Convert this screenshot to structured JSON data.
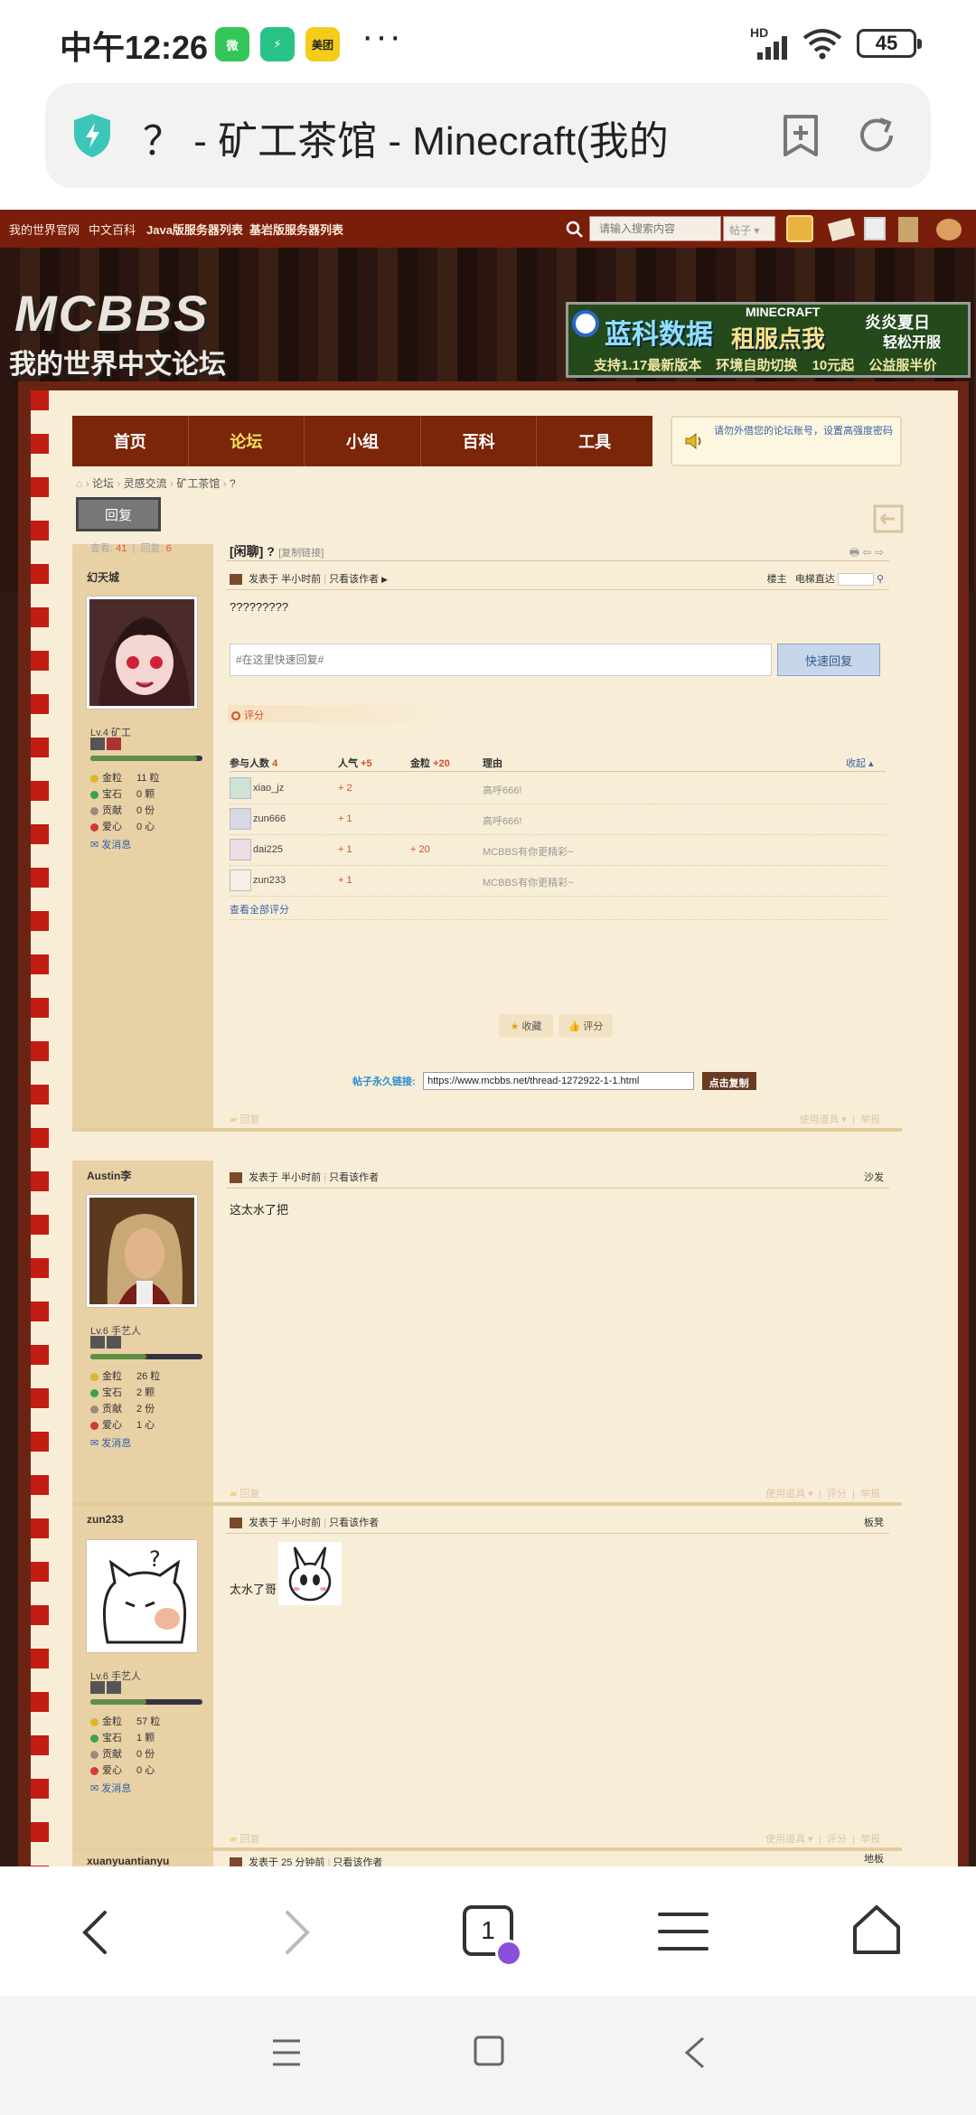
{
  "status_bar": {
    "time": "中午12:26",
    "apps": [
      {
        "name": "wechat-icon",
        "label": "微",
        "color": "#33c759"
      },
      {
        "name": "accelerator-icon",
        "label": "⚡",
        "color": "#29c286"
      },
      {
        "name": "meituan-icon",
        "label": "美团",
        "color": "#f5cc1b"
      }
    ],
    "more": "···",
    "network": "HD",
    "battery": "45"
  },
  "address_bar": {
    "title": "？ - 矿工茶馆 - Minecraft(我的"
  },
  "forum": {
    "top_links": [
      "我的世界官网",
      "中文百科",
      "Java版服务器列表",
      "基岩版服务器列表"
    ],
    "search_placeholder": "请输入搜索内容",
    "search_scope": "帖子",
    "logo": "MCBBS",
    "logo_sub": "我的世界中文论坛",
    "ad": {
      "brand": "MINECRAFT",
      "title": "蓝科数据",
      "mid": "租服点我",
      "line1": "炎炎夏日",
      "line2": "轻松开服",
      "bottom": [
        "支持1.17最新版本",
        "环境自助切换",
        "10元起",
        "公益服半价"
      ]
    },
    "nav": [
      {
        "label": "首页",
        "active": false
      },
      {
        "label": "论坛",
        "active": true
      },
      {
        "label": "小组",
        "active": false
      },
      {
        "label": "百科",
        "active": false
      },
      {
        "label": "工具",
        "active": false
      }
    ],
    "notice": "请勿外借您的论坛账号，设置高强度密码",
    "breadcrumb": [
      "论坛",
      "灵感交流",
      "矿工茶馆",
      "?"
    ],
    "reply_button": "回复",
    "thread": {
      "views_label": "查看:",
      "views": "41",
      "replies_label": "回复:",
      "replies": "6",
      "title": "[闲聊] ?",
      "copy_link": "[复制链接]"
    },
    "posts": [
      {
        "username": "幻天城",
        "level": "Lv.4 矿工",
        "xp": 0.95,
        "stats": [
          {
            "k": "金粒",
            "v": "11 粒",
            "color": "#e0b52a"
          },
          {
            "k": "宝石",
            "v": "0 颗",
            "color": "#3aa34a"
          },
          {
            "k": "贡献",
            "v": "0 份",
            "color": "#9a8a80"
          },
          {
            "k": "爱心",
            "v": "0 心",
            "color": "#d23c2c"
          }
        ],
        "message": "发消息",
        "meta": "发表于 半小时前",
        "only_author": "只看该作者",
        "floor": "楼主",
        "floor_jump": "电梯直达",
        "body": "?????????",
        "quick_reply_placeholder": "#在这里快速回复#",
        "quick_reply_button": "快速回复",
        "rate_label": "评分",
        "rate_headers": {
          "users": "参与人数",
          "users_count": "4",
          "pop": "人气",
          "pop_sum": "+5",
          "gold": "金粒",
          "gold_sum": "+20",
          "reason": "理由",
          "collapse": "收起"
        },
        "rates": [
          {
            "user": "xiao_jz",
            "pop": "+ 2",
            "gold": "",
            "reason": "高呼666!"
          },
          {
            "user": "zun666",
            "pop": "+ 1",
            "gold": "",
            "reason": "高呼666!"
          },
          {
            "user": "dai225",
            "pop": "+ 1",
            "gold": "+ 20",
            "reason": "MCBBS有你更精彩~"
          },
          {
            "user": "zun233",
            "pop": "+ 1",
            "gold": "",
            "reason": "MCBBS有你更精彩~"
          }
        ],
        "view_all_rates": "查看全部评分",
        "favorite": "收藏",
        "rate": "评分",
        "permalink_label": "帖子永久链接:",
        "permalink": "https://www.mcbbs.net/thread-1272922-1-1.html",
        "copy_button": "点击复制",
        "footer_reply": "回复",
        "footer_tools": "使用道具",
        "footer_report": "举报"
      },
      {
        "username": "Austin李",
        "level": "Lv.6 手艺人",
        "xp": 0.5,
        "stats": [
          {
            "k": "金粒",
            "v": "26 粒",
            "color": "#e0b52a"
          },
          {
            "k": "宝石",
            "v": "2 颗",
            "color": "#3aa34a"
          },
          {
            "k": "贡献",
            "v": "2 份",
            "color": "#9a8a80"
          },
          {
            "k": "爱心",
            "v": "1 心",
            "color": "#d23c2c"
          }
        ],
        "message": "发消息",
        "meta": "发表于 半小时前",
        "only_author": "只看该作者",
        "floor": "沙发",
        "body": "这太水了把",
        "footer_reply": "回复",
        "footer_tools": "使用道具",
        "footer_rate": "评分",
        "footer_report": "举报"
      },
      {
        "username": "zun233",
        "level": "Lv.6 手艺人",
        "xp": 0.5,
        "stats": [
          {
            "k": "金粒",
            "v": "57 粒",
            "color": "#e0b52a"
          },
          {
            "k": "宝石",
            "v": "1 颗",
            "color": "#3aa34a"
          },
          {
            "k": "贡献",
            "v": "0 份",
            "color": "#9a8a80"
          },
          {
            "k": "爱心",
            "v": "0 心",
            "color": "#d23c2c"
          }
        ],
        "message": "发消息",
        "meta": "发表于 半小时前",
        "only_author": "只看该作者",
        "floor": "板凳",
        "body": "太水了哥",
        "footer_reply": "回复",
        "footer_tools": "使用道具",
        "footer_rate": "评分",
        "footer_report": "举报"
      },
      {
        "username": "xuanyuantianyu",
        "meta": "发表于 25 分钟前",
        "only_author": "只看该作者",
        "floor": "地板"
      }
    ]
  },
  "browser_bar": {
    "tab_count": "1"
  }
}
